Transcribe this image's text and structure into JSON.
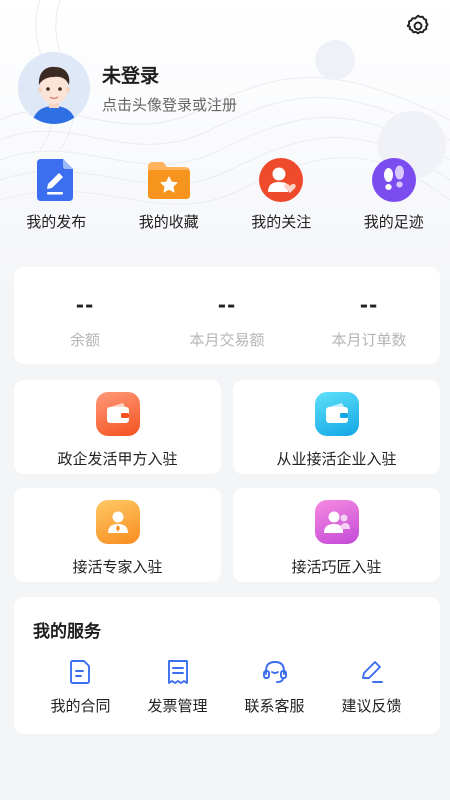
{
  "profile": {
    "name": "未登录",
    "hint": "点击头像登录或注册",
    "avatar_icon": "user-avatar-icon"
  },
  "header": {
    "settings_icon": "gear-icon"
  },
  "quick_actions": [
    {
      "label": "我的发布",
      "icon": "document-edit-icon",
      "color": "#3b6ff0"
    },
    {
      "label": "我的收藏",
      "icon": "folder-star-icon",
      "color": "#f7941d"
    },
    {
      "label": "我的关注",
      "icon": "user-heart-icon",
      "color": "#f04a2c"
    },
    {
      "label": "我的足迹",
      "icon": "footprints-icon",
      "color": "#7b4cf0"
    }
  ],
  "stats": [
    {
      "value": "--",
      "label": "余额"
    },
    {
      "value": "--",
      "label": "本月交易额"
    },
    {
      "value": "--",
      "label": "本月订单数"
    }
  ],
  "entry_cards": [
    {
      "label": "政企发活甲方入驻",
      "icon": "wallet-icon",
      "color_from": "#ff8a65",
      "color_to": "#f4511e"
    },
    {
      "label": "从业接活企业入驻",
      "icon": "wallet-icon",
      "color_from": "#4dd8f5",
      "color_to": "#12a6e6"
    },
    {
      "label": "接活专家入驻",
      "icon": "expert-user-icon",
      "color_from": "#ffc15a",
      "color_to": "#f78c1e"
    },
    {
      "label": "接活巧匠入驻",
      "icon": "craftsman-user-icon",
      "color_from": "#f07bd6",
      "color_to": "#c44ad8"
    }
  ],
  "services": {
    "title": "我的服务",
    "items": [
      {
        "label": "我的合同",
        "icon": "contract-icon"
      },
      {
        "label": "发票管理",
        "icon": "invoice-icon"
      },
      {
        "label": "联系客服",
        "icon": "headset-icon"
      },
      {
        "label": "建议反馈",
        "icon": "pencil-feedback-icon"
      }
    ],
    "accent": "#3b6ff0"
  }
}
